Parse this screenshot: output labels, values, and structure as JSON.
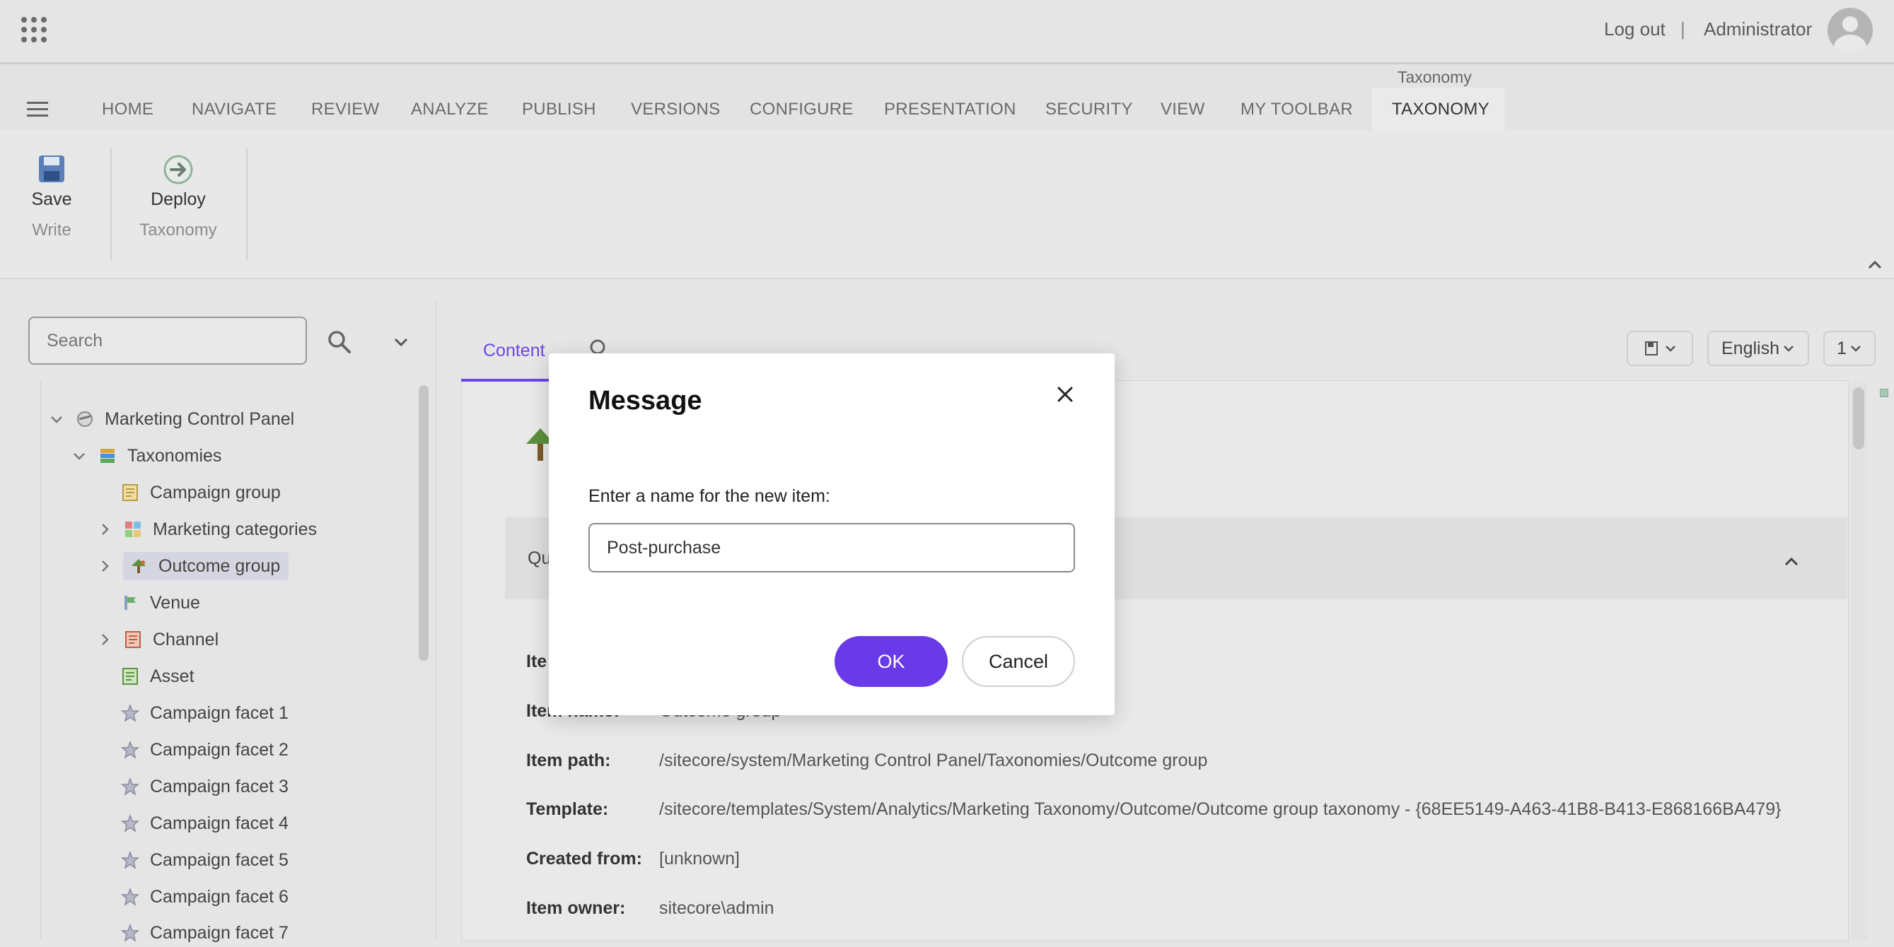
{
  "header": {
    "logout_label": "Log out",
    "separator": "|",
    "username": "Administrator"
  },
  "ribbon": {
    "active_tab_caption": "Taxonomy",
    "tabs": [
      "HOME",
      "NAVIGATE",
      "REVIEW",
      "ANALYZE",
      "PUBLISH",
      "VERSIONS",
      "CONFIGURE",
      "PRESENTATION",
      "SECURITY",
      "VIEW",
      "MY TOOLBAR",
      "TAXONOMY"
    ],
    "active_tab": "TAXONOMY",
    "groups": [
      {
        "button_label": "Save",
        "group_label": "Write",
        "icon": "save-icon"
      },
      {
        "button_label": "Deploy",
        "group_label": "Taxonomy",
        "icon": "deploy-icon"
      }
    ]
  },
  "tree": {
    "search_placeholder": "Search",
    "items": [
      {
        "label": "Marketing Control Panel",
        "icon": "marketing-control-panel-icon",
        "expanded": true
      },
      {
        "label": "Taxonomies",
        "icon": "taxonomies-icon",
        "expanded": true
      },
      {
        "label": "Campaign group",
        "icon": "campaign-group-icon"
      },
      {
        "label": "Marketing categories",
        "icon": "marketing-categories-icon",
        "expandable": true
      },
      {
        "label": "Outcome group",
        "icon": "outcome-group-icon",
        "expandable": true,
        "selected": true
      },
      {
        "label": "Venue",
        "icon": "venue-icon"
      },
      {
        "label": "Channel",
        "icon": "channel-icon",
        "expandable": true
      },
      {
        "label": "Asset",
        "icon": "asset-icon"
      },
      {
        "label": "Campaign facet 1",
        "icon": "star-icon"
      },
      {
        "label": "Campaign facet 2",
        "icon": "star-icon"
      },
      {
        "label": "Campaign facet 3",
        "icon": "star-icon"
      },
      {
        "label": "Campaign facet 4",
        "icon": "star-icon"
      },
      {
        "label": "Campaign facet 5",
        "icon": "star-icon"
      },
      {
        "label": "Campaign facet 6",
        "icon": "star-icon"
      },
      {
        "label": "Campaign facet 7",
        "icon": "star-icon"
      }
    ]
  },
  "content": {
    "tab_label": "Content",
    "language": "English",
    "version": "1",
    "section_label": "Qu",
    "fields": [
      {
        "label": "Ite",
        "value": ""
      },
      {
        "label": "Item name:",
        "value": "Outcome group"
      },
      {
        "label": "Item path:",
        "value": "/sitecore/system/Marketing Control Panel/Taxonomies/Outcome group"
      },
      {
        "label": "Template:",
        "value": "/sitecore/templates/System/Analytics/Marketing Taxonomy/Outcome/Outcome group taxonomy - {68EE5149-A463-41B8-B413-E868166BA479}"
      },
      {
        "label": "Created from:",
        "value": "[unknown]"
      },
      {
        "label": "Item owner:",
        "value": "sitecore\\admin"
      }
    ]
  },
  "dialog": {
    "title": "Message",
    "prompt": "Enter a name for the new item:",
    "input_value": "Post-purchase",
    "ok_label": "OK",
    "cancel_label": "Cancel"
  },
  "colors": {
    "accent": "#6b3ae8",
    "tab_active": "#6b46e6"
  }
}
